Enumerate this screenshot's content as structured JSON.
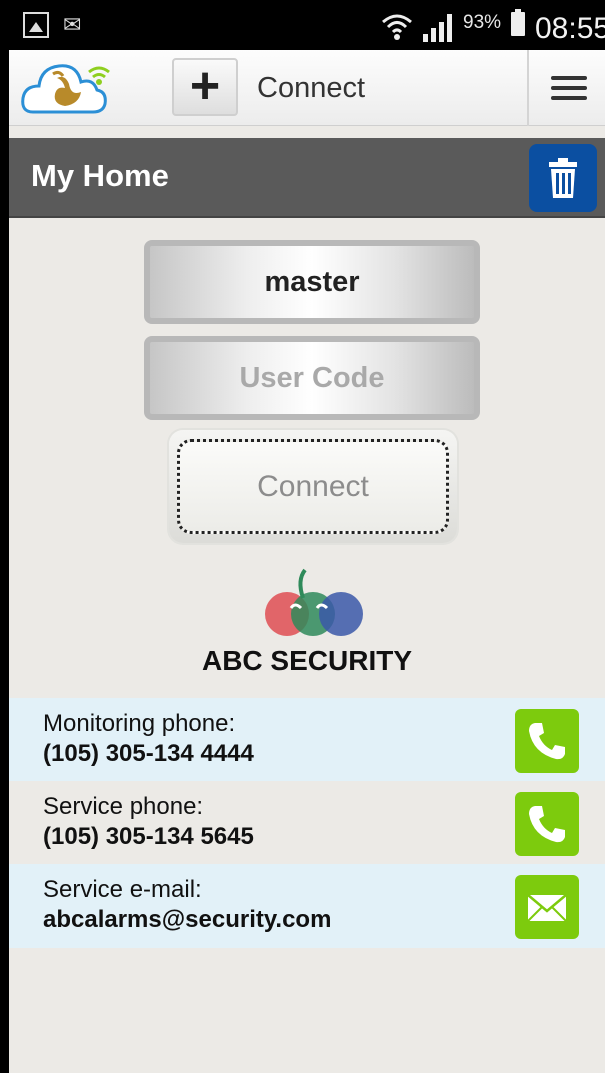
{
  "status_bar": {
    "battery_percent": "93%",
    "time": "08:55",
    "icons": [
      "image-icon",
      "mail-icon",
      "wifi-icon",
      "signal-icon",
      "battery-icon"
    ]
  },
  "toolbar": {
    "title": "Connect",
    "add_icon": "plus-icon",
    "menu_icon": "hamburger-icon",
    "logo": "swan-cloud-logo"
  },
  "header": {
    "title": "My Home",
    "delete_icon": "trash-icon"
  },
  "form": {
    "username_value": "master",
    "usercode_placeholder": "User Code",
    "connect_label": "Connect"
  },
  "brand": {
    "name": "ABC SECURITY"
  },
  "contacts": [
    {
      "label": "Monitoring phone:",
      "value": "(105) 305-134 4444",
      "icon": "phone-icon"
    },
    {
      "label": "Service phone:",
      "value": "(105) 305-134 5645",
      "icon": "phone-icon"
    },
    {
      "label": "Service e-mail:",
      "value": "abcalarms@security.com",
      "icon": "mail-icon"
    }
  ],
  "colors": {
    "header_bg": "#5a5a5a",
    "trash_button": "#0b4fa1",
    "action_green": "#7dcb0d",
    "row_highlight": "#e2f1f8"
  }
}
